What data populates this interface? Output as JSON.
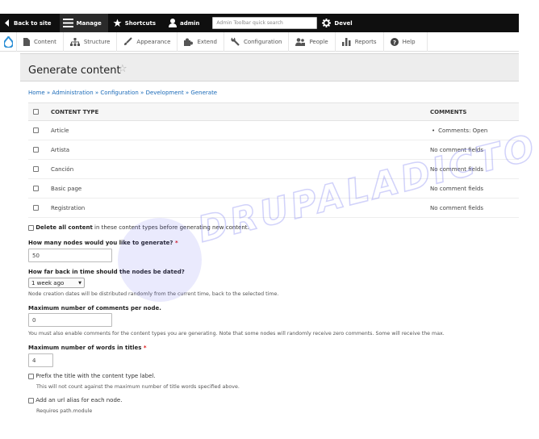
{
  "toolbar": {
    "back": "Back to site",
    "manage": "Manage",
    "shortcuts": "Shortcuts",
    "user": "admin",
    "search_placeholder": "Admin Toolbar quick search",
    "devel": "Devel"
  },
  "tray": {
    "items": [
      {
        "label": "Content",
        "icon": "file-icon"
      },
      {
        "label": "Structure",
        "icon": "structure-icon"
      },
      {
        "label": "Appearance",
        "icon": "brush-icon"
      },
      {
        "label": "Extend",
        "icon": "puzzle-icon"
      },
      {
        "label": "Configuration",
        "icon": "wrench-icon"
      },
      {
        "label": "People",
        "icon": "people-icon"
      },
      {
        "label": "Reports",
        "icon": "chart-icon"
      },
      {
        "label": "Help",
        "icon": "help-icon"
      }
    ]
  },
  "page": {
    "title": "Generate content",
    "breadcrumb": "Home » Administration » Configuration » Development » Generate"
  },
  "table": {
    "headers": {
      "type": "CONTENT TYPE",
      "comments": "COMMENTS"
    },
    "rows": [
      {
        "type": "Article",
        "comments": "Comments: Open",
        "bullet": "•"
      },
      {
        "type": "Artista",
        "comments": "No comment fields"
      },
      {
        "type": "Canción",
        "comments": "No comment fields"
      },
      {
        "type": "Basic page",
        "comments": "No comment fields"
      },
      {
        "type": "Registration",
        "comments": "No comment fields"
      }
    ]
  },
  "form": {
    "delete_bold": "Delete all content",
    "delete_rest": " in these content types before generating new content.",
    "nodes_label": "How many nodes would you like to generate?",
    "required_mark": "*",
    "nodes_value": "50",
    "time_label": "How far back in time should the nodes be dated?",
    "time_value": "1 week ago",
    "time_desc": "Node creation dates will be distributed randomly from the current time, back to the selected time.",
    "comments_label": "Maximum number of comments per node.",
    "comments_value": "0",
    "comments_desc": "You must also enable comments for the content types you are generating. Note that some nodes will randomly receive zero comments. Some will receive the max.",
    "words_label": "Maximum number of words in titles",
    "words_value": "4",
    "prefix_label": "Prefix the title with the content type label.",
    "prefix_desc": "This will not count against the maximum number of title words specified above.",
    "alias_label": "Add an url alias for each node.",
    "alias_desc": "Requires path.module"
  },
  "watermark": {
    "text": "DRUPALADICTO"
  },
  "colors": {
    "toolbar": "#0f0f0f",
    "link": "#1a6ab8",
    "drupal_blue": "#2b8fd6",
    "required": "#d11111"
  }
}
